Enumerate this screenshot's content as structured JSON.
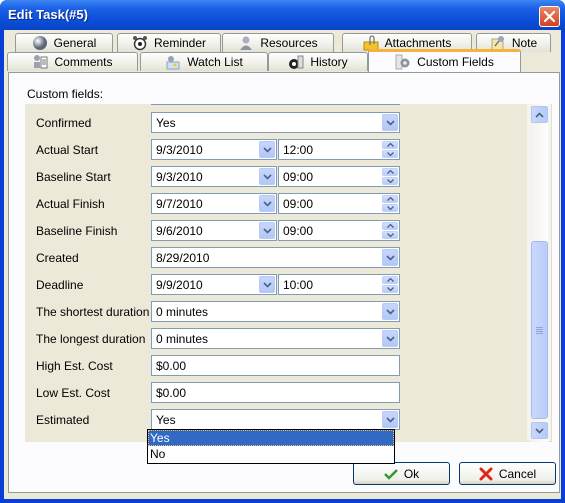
{
  "window": {
    "title": "Edit Task(#5)",
    "close_label": "Close"
  },
  "tabs": {
    "row1": [
      {
        "label": "General",
        "icon": "sphere-icon"
      },
      {
        "label": "Reminder",
        "icon": "alarm-clock-icon"
      },
      {
        "label": "Resources",
        "icon": "user-icon"
      },
      {
        "label": "Attachments",
        "icon": "paperclip-folder-icon"
      },
      {
        "label": "Note",
        "icon": "pushpin-icon"
      }
    ],
    "row2": [
      {
        "label": "Comments",
        "icon": "comments-icon"
      },
      {
        "label": "Watch List",
        "icon": "watch-list-icon"
      },
      {
        "label": "History",
        "icon": "history-icon"
      },
      {
        "label": "Custom Fields",
        "icon": "gear-icon",
        "active": true
      }
    ]
  },
  "panel": {
    "section_label": "Custom fields:"
  },
  "fields": [
    {
      "label": "Confirmed",
      "type": "select",
      "value": "Yes"
    },
    {
      "label": "Actual Start",
      "type": "datetime",
      "date": "9/3/2010",
      "time": "12:00"
    },
    {
      "label": "Baseline Start",
      "type": "datetime",
      "date": "9/3/2010",
      "time": "09:00"
    },
    {
      "label": "Actual Finish",
      "type": "datetime",
      "date": "9/7/2010",
      "time": "09:00"
    },
    {
      "label": "Baseline Finish",
      "type": "datetime",
      "date": "9/6/2010",
      "time": "09:00"
    },
    {
      "label": "Created",
      "type": "select",
      "value": "8/29/2010"
    },
    {
      "label": "Deadline",
      "type": "datetime",
      "date": "9/9/2010",
      "time": "10:00"
    },
    {
      "label": "The shortest duration",
      "type": "select",
      "value": "0 minutes"
    },
    {
      "label": "The longest duration",
      "type": "select",
      "value": "0 minutes"
    },
    {
      "label": "High Est. Cost",
      "type": "text",
      "value": "$0.00"
    },
    {
      "label": "Low Est. Cost",
      "type": "text",
      "value": "$0.00"
    },
    {
      "label": "Estimated",
      "type": "select",
      "value": "Yes"
    }
  ],
  "dropdown": {
    "options": [
      "Yes",
      "No"
    ],
    "selected": "Yes"
  },
  "scrollbar": {
    "position_fraction": 1.0
  },
  "buttons": {
    "ok": "Ok",
    "cancel": "Cancel"
  },
  "colors": {
    "title_bar": "#0a4ed8",
    "selection": "#316ac5",
    "active_tab_accent": "#f5b23c"
  }
}
